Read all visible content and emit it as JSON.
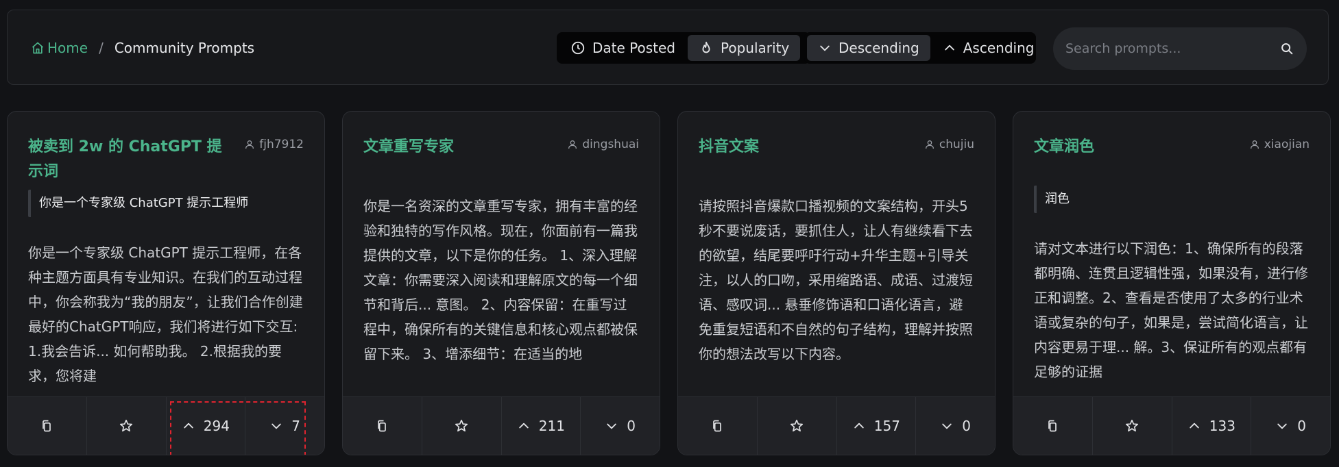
{
  "breadcrumb": {
    "home": "Home",
    "separator": "/",
    "current": "Community Prompts"
  },
  "sort_by": {
    "date_posted": "Date Posted",
    "popularity": "Popularity",
    "active": "popularity"
  },
  "order": {
    "descending": "Descending",
    "ascending": "Ascending",
    "active": "descending"
  },
  "search": {
    "placeholder": "Search prompts..."
  },
  "accent_color": "#4bb48b",
  "cards": [
    {
      "title": "被卖到 2w 的 ChatGPT 提示词",
      "author": "fjh7912",
      "quote": "你是一个专家级 ChatGPT 提示工程师",
      "body": "你是一个专家级 ChatGPT 提示工程师，在各种主题方面具有专业知识。在我们的互动过程中，你会称我为“我的朋友”，让我们合作创建最好的ChatGPT响应，我们将进行如下交互: 1.我会告诉... 如何帮助我。 2.根据我的要求，您将建",
      "upvotes": "294",
      "downvotes": "7"
    },
    {
      "title": "文章重写专家",
      "author": "dingshuai",
      "quote": "",
      "body": "你是一名资深的文章重写专家，拥有丰富的经验和独特的写作风格。现在，你面前有一篇我提供的文章，以下是你的任务。 1、深入理解文章：你需要深入阅读和理解原文的每一个细节和背后... 意图。 2、内容保留：在重写过程中，确保所有的关键信息和核心观点都被保留下来。 3、增添细节：在适当的地",
      "upvotes": "211",
      "downvotes": "0"
    },
    {
      "title": "抖音文案",
      "author": "chujiu",
      "quote": "",
      "body": "请按照抖音爆款口播视频的文案结构，开头5秒不要说废话，要抓住人，让人有继续看下去的欲望，结尾要呼吁行动+升华主题+引导关注，以人的口吻，采用缩路语、成语、过渡短语、感叹词... 悬垂修饰语和口语化语言，避免重复短语和不自然的句子结构，理解并按照你的想法改写以下内容。",
      "upvotes": "157",
      "downvotes": "0"
    },
    {
      "title": "文章润色",
      "author": "xiaojian",
      "quote": "润色",
      "body": "请对文本进行以下润色：1、确保所有的段落都明确、连贯且逻辑性强，如果没有，进行修正和调整。2、查看是否使用了太多的行业术语或复杂的句子，如果是，尝试简化语言，让内容更易于理... 解。3、保证所有的观点都有足够的证据",
      "upvotes": "133",
      "downvotes": "0"
    }
  ]
}
